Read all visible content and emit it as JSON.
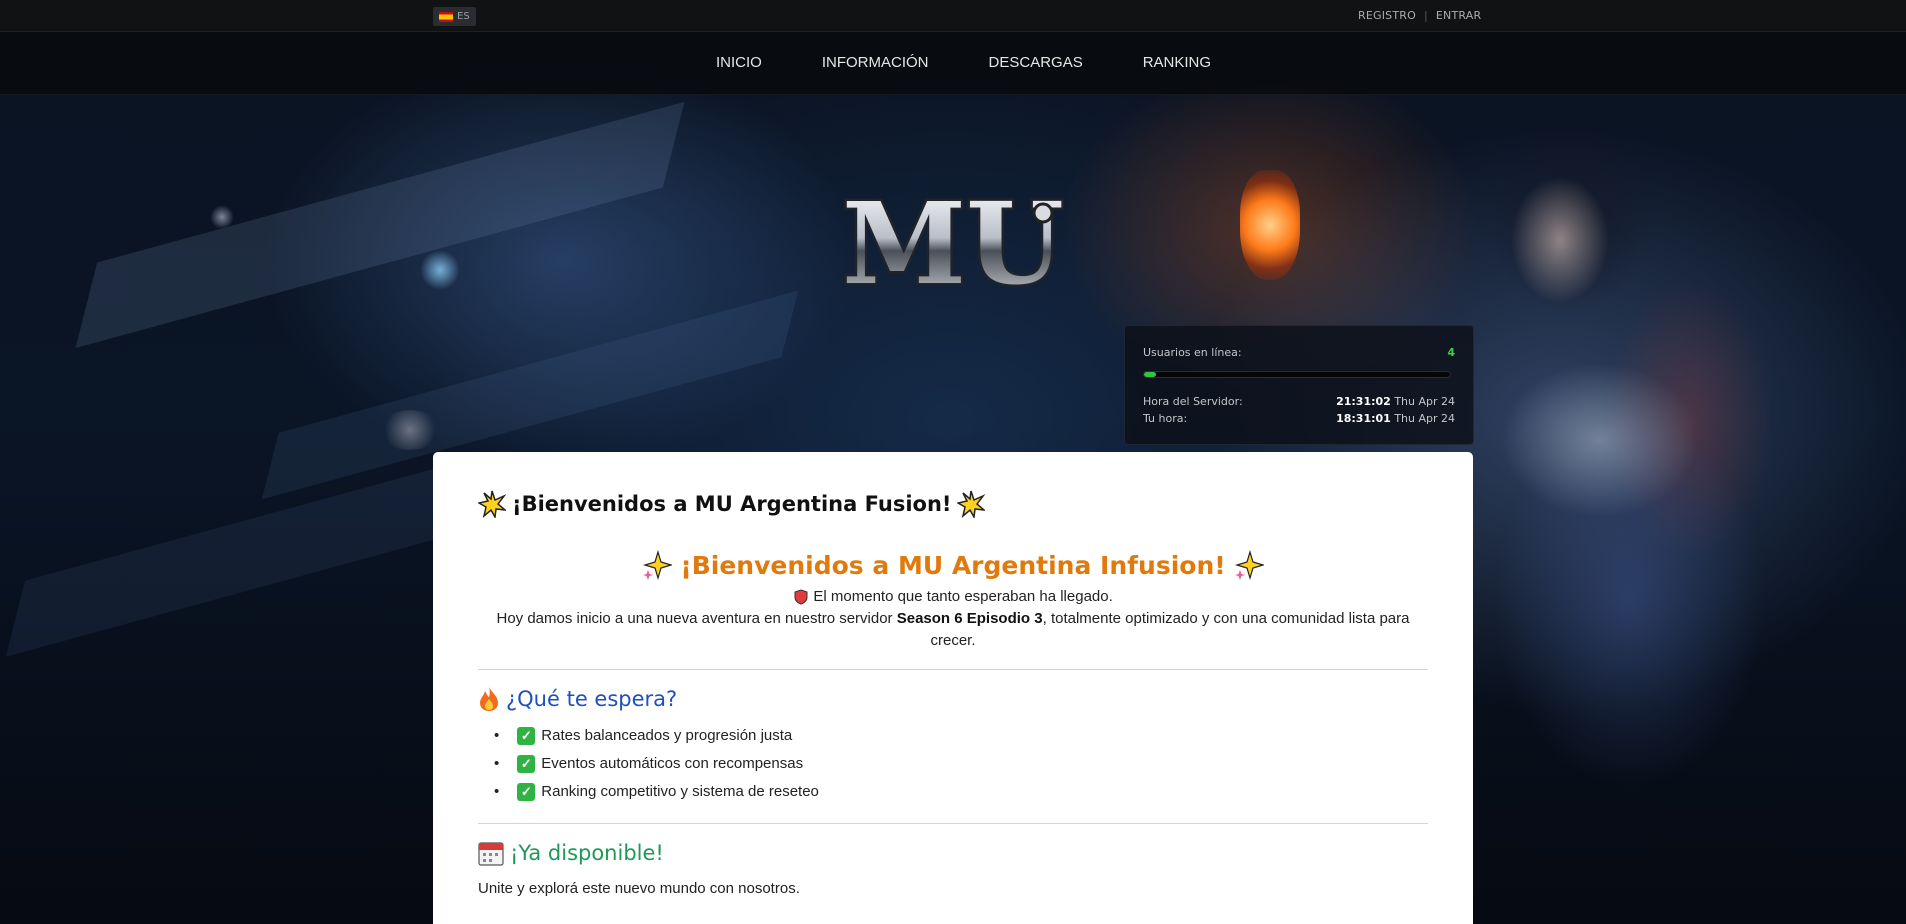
{
  "topbar": {
    "language_code": "ES",
    "flag_icon": "spain-flag-icon",
    "register_label": "REGISTRO",
    "separator": "|",
    "login_label": "ENTRAR"
  },
  "nav": {
    "items": [
      {
        "label": "INICIO"
      },
      {
        "label": "INFORMACIÓN"
      },
      {
        "label": "DESCARGAS"
      },
      {
        "label": "RANKING"
      }
    ]
  },
  "logo": {
    "text": "MU"
  },
  "server": {
    "online_label": "Usuarios en línea:",
    "online_count": "4",
    "online_fill_fraction": 0.04,
    "server_time_label": "Hora del Servidor:",
    "server_time": "21:31:02",
    "server_date": "Thu Apr 24",
    "your_time_label": "Tu hora:",
    "your_time": "18:31:01",
    "your_date": "Thu Apr 24"
  },
  "content": {
    "title": "¡Bienvenidos a MU Argentina Fusion!",
    "welcome_heading": "¡Bienvenidos a MU Argentina Infusion!",
    "intro_line1": "El momento que tanto esperaban ha llegado.",
    "intro_line2_before": "Hoy damos inicio a una nueva aventura en nuestro servidor ",
    "intro_line2_bold": "Season 6 Episodio 3",
    "intro_line2_after": ", totalmente optimizado y con una comunidad lista para crecer.",
    "expect_heading": "¿Qué te espera?",
    "features": [
      {
        "text": "Rates balanceados y progresión justa"
      },
      {
        "text": "Eventos automáticos con recompensas"
      },
      {
        "text": "Ranking competitivo y sistema de reseteo"
      }
    ],
    "available_heading": "¡Ya disponible!",
    "available_text": "Unite y explorá este nuevo mundo con nosotros."
  },
  "colors": {
    "accent_orange": "#e07a0c",
    "heading_blue": "#1f4fbf",
    "heading_green": "#1d9a57",
    "online_green": "#3fd14a"
  }
}
